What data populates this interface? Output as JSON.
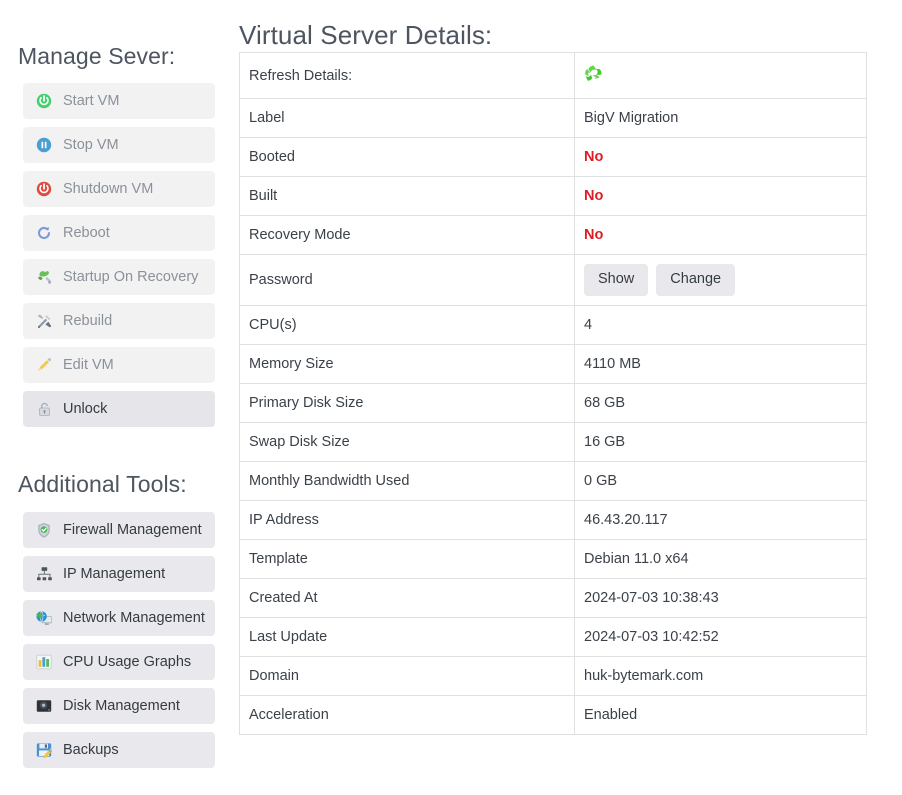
{
  "sidebar": {
    "manage": {
      "heading": "Manage Sever:",
      "items": [
        {
          "label": "Start VM",
          "icon": "power-on-icon",
          "state": "disabled"
        },
        {
          "label": "Stop VM",
          "icon": "pause-icon",
          "state": "disabled"
        },
        {
          "label": "Shutdown VM",
          "icon": "power-off-icon",
          "state": "disabled"
        },
        {
          "label": "Reboot",
          "icon": "reboot-icon",
          "state": "disabled"
        },
        {
          "label": "Startup On Recovery",
          "icon": "recovery-plug-icon",
          "state": "disabled"
        },
        {
          "label": "Rebuild",
          "icon": "tools-icon",
          "state": "disabled"
        },
        {
          "label": "Edit VM",
          "icon": "pencil-icon",
          "state": "disabled"
        },
        {
          "label": "Unlock",
          "icon": "padlock-icon",
          "state": "active"
        }
      ]
    },
    "tools": {
      "heading": "Additional Tools:",
      "items": [
        {
          "label": "Firewall Management",
          "icon": "shield-check-icon"
        },
        {
          "label": "IP Management",
          "icon": "sitemap-icon"
        },
        {
          "label": "Network Management",
          "icon": "globe-monitor-icon"
        },
        {
          "label": "CPU Usage Graphs",
          "icon": "bar-chart-icon"
        },
        {
          "label": "Disk Management",
          "icon": "hard-disk-icon"
        },
        {
          "label": "Backups",
          "icon": "floppy-pencil-icon"
        }
      ]
    }
  },
  "main": {
    "title": "Virtual Server Details:",
    "rows": [
      {
        "key": "Refresh Details:",
        "value": "",
        "type": "refresh-icon"
      },
      {
        "key": "Label",
        "value": "BigV Migration",
        "type": "text"
      },
      {
        "key": "Booted",
        "value": "No",
        "type": "negative"
      },
      {
        "key": "Built",
        "value": "No",
        "type": "negative"
      },
      {
        "key": "Recovery Mode",
        "value": "No",
        "type": "negative"
      },
      {
        "key": "Password",
        "value": "",
        "type": "buttons"
      },
      {
        "key": "CPU(s)",
        "value": "4",
        "type": "text"
      },
      {
        "key": "Memory Size",
        "value": "4110 MB",
        "type": "text"
      },
      {
        "key": "Primary Disk Size",
        "value": "68 GB",
        "type": "text"
      },
      {
        "key": "Swap Disk Size",
        "value": "16 GB",
        "type": "text"
      },
      {
        "key": "Monthly Bandwidth Used",
        "value": "0 GB",
        "type": "text"
      },
      {
        "key": "IP Address",
        "value": "46.43.20.117",
        "type": "text"
      },
      {
        "key": "Template",
        "value": "Debian 11.0 x64",
        "type": "text"
      },
      {
        "key": "Created At",
        "value": "2024-07-03 10:38:43",
        "type": "text"
      },
      {
        "key": "Last Update",
        "value": "2024-07-03 10:42:52",
        "type": "text"
      },
      {
        "key": "Domain",
        "value": "huk-bytemark.com",
        "type": "text"
      },
      {
        "key": "Acceleration",
        "value": "Enabled",
        "type": "text"
      }
    ],
    "password_buttons": [
      {
        "label": "Show",
        "name": "show-password-button"
      },
      {
        "label": "Change",
        "name": "change-password-button"
      }
    ]
  },
  "colors": {
    "negative": "#e01b24",
    "refresh_green": "#5bd24a",
    "btn_bg": "#e9e9ed",
    "disabled_text": "#8b9199",
    "heading": "#4d5560"
  }
}
